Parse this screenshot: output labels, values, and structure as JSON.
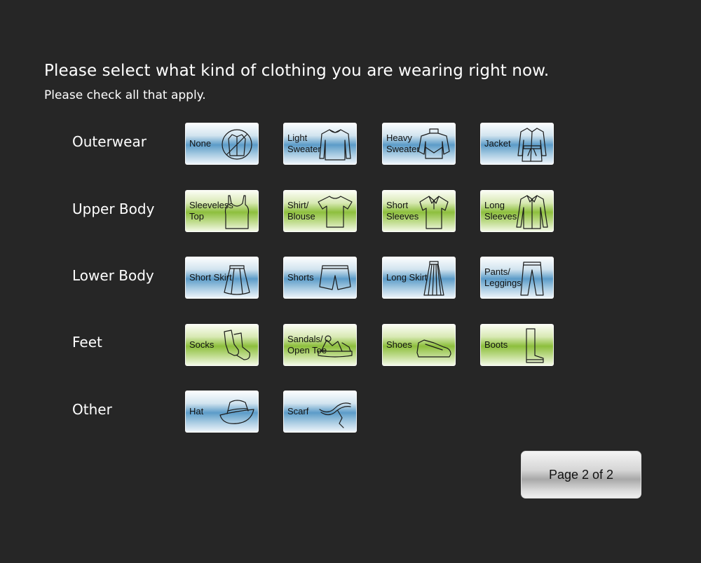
{
  "question": "Please select what kind of clothing you are wearing right now.",
  "instruction": "Please check all that apply.",
  "categories": [
    {
      "label": "Outerwear",
      "options": [
        {
          "label": "None",
          "icon": "no-jacket-icon",
          "color": "blue"
        },
        {
          "label": "Light\nSweater",
          "icon": "light-sweater-icon",
          "color": "blue"
        },
        {
          "label": "Heavy\nSweater",
          "icon": "heavy-sweater-icon",
          "color": "blue"
        },
        {
          "label": "Jacket",
          "icon": "jacket-icon",
          "color": "blue"
        }
      ]
    },
    {
      "label": "Upper Body",
      "options": [
        {
          "label": "Sleeveless\nTop",
          "icon": "tank-top-icon",
          "color": "green"
        },
        {
          "label": "Shirt/\nBlouse",
          "icon": "t-shirt-icon",
          "color": "green"
        },
        {
          "label": "Short\nSleeves",
          "icon": "polo-shirt-icon",
          "color": "green"
        },
        {
          "label": "Long\nSleeves",
          "icon": "long-sleeve-shirt-icon",
          "color": "green"
        }
      ]
    },
    {
      "label": "Lower Body",
      "options": [
        {
          "label": "Short Skirt",
          "icon": "short-skirt-icon",
          "color": "blue"
        },
        {
          "label": "Shorts",
          "icon": "shorts-icon",
          "color": "blue"
        },
        {
          "label": "Long Skirt",
          "icon": "long-skirt-icon",
          "color": "blue"
        },
        {
          "label": "Pants/\nLeggings",
          "icon": "pants-icon",
          "color": "blue"
        }
      ]
    },
    {
      "label": "Feet",
      "options": [
        {
          "label": "Socks",
          "icon": "socks-icon",
          "color": "green"
        },
        {
          "label": "Sandals/\nOpen Toe",
          "icon": "sandal-icon",
          "color": "green"
        },
        {
          "label": "Shoes",
          "icon": "shoe-icon",
          "color": "green"
        },
        {
          "label": "Boots",
          "icon": "boot-icon",
          "color": "green"
        }
      ]
    },
    {
      "label": "Other",
      "options": [
        {
          "label": "Hat",
          "icon": "hat-icon",
          "color": "blue"
        },
        {
          "label": "Scarf",
          "icon": "scarf-icon",
          "color": "blue"
        }
      ]
    }
  ],
  "page_button": "Page 2 of 2",
  "colors": {
    "background": "#262626",
    "blue_button": "#5c9cc8",
    "green_button": "#8dbf3d"
  }
}
